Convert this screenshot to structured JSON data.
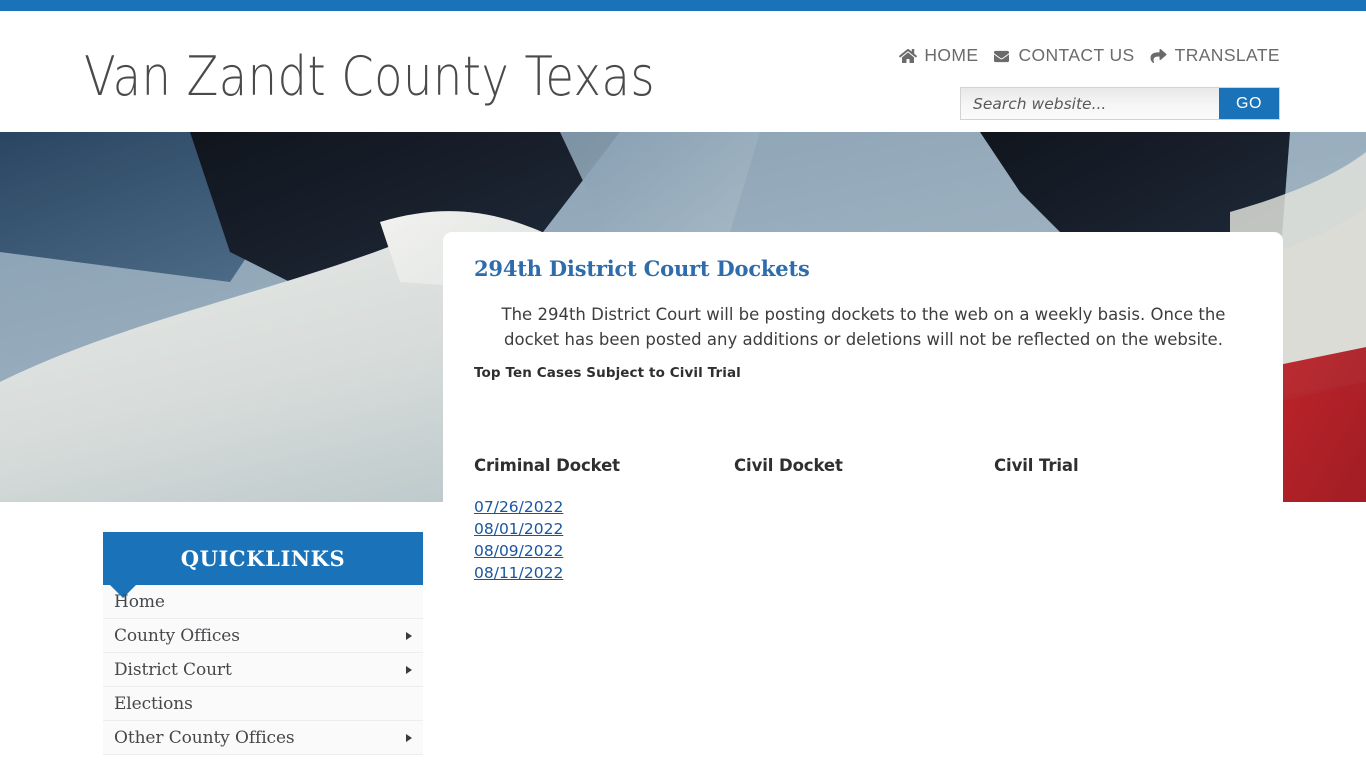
{
  "theme": {
    "accent_blue": "#1a73b8",
    "link_blue": "#1a56a0",
    "heading_blue": "#2f6cab",
    "text_gray": "#4a4a4a"
  },
  "header": {
    "site_title": "Van Zandt County Texas",
    "nav": [
      {
        "icon": "home-icon",
        "label": "HOME"
      },
      {
        "icon": "envelope-icon",
        "label": "CONTACT US"
      },
      {
        "icon": "share-arrow-icon",
        "label": "TRANSLATE"
      }
    ],
    "search": {
      "placeholder": "Search website...",
      "value": "",
      "button_label": "GO"
    }
  },
  "hero": {
    "image_name": "american-flag-closeup"
  },
  "content": {
    "title": "294th District Court Dockets",
    "intro": "The 294th District Court will be posting dockets to the web on a weekly basis. Once the docket has been posted any additions or deletions will not be reflected on the website.",
    "subheading": "Top Ten Cases Subject to Civil Trial",
    "columns": [
      {
        "heading": "Criminal Docket",
        "links": [
          "07/26/2022",
          "08/01/2022",
          "08/09/2022",
          "08/11/2022"
        ]
      },
      {
        "heading": "Civil Docket",
        "links": []
      },
      {
        "heading": "Civil Trial",
        "links": []
      }
    ]
  },
  "sidebar": {
    "title": "QUICKLINKS",
    "items": [
      {
        "label": "Home",
        "has_submenu": false
      },
      {
        "label": "County Offices",
        "has_submenu": true
      },
      {
        "label": "District Court",
        "has_submenu": true
      },
      {
        "label": "Elections",
        "has_submenu": false
      },
      {
        "label": "Other County Offices",
        "has_submenu": true
      }
    ]
  }
}
